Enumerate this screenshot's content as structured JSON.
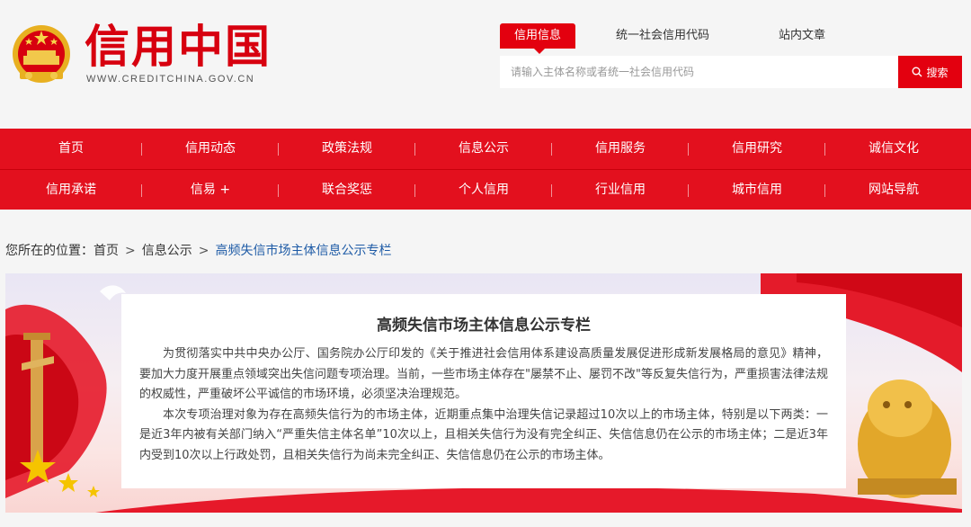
{
  "brand": {
    "title": "信用中国",
    "url": "WWW.CREDITCHINA.GOV.CN",
    "colors": {
      "primary": "#e3000f",
      "nav": "#e3101e",
      "link": "#1e5ba6"
    }
  },
  "search": {
    "tabs": [
      "信用信息",
      "统一社会信用代码",
      "站内文章"
    ],
    "active_tab": "信用信息",
    "placeholder": "请输入主体名称或者统一社会信用代码",
    "button_label": "搜索",
    "button_icon": "search-icon"
  },
  "nav": {
    "row1": [
      "首页",
      "信用动态",
      "政策法规",
      "信息公示",
      "信用服务",
      "信用研究",
      "诚信文化"
    ],
    "row2": [
      "信用承诺",
      "信易 +",
      "联合奖惩",
      "个人信用",
      "行业信用",
      "城市信用",
      "网站导航"
    ]
  },
  "breadcrumb": {
    "prefix": "您所在的位置：",
    "items": [
      "首页",
      "信息公示"
    ],
    "current": "高频失信市场主体信息公示专栏",
    "separator": ">"
  },
  "banner": {
    "title": "高频失信市场主体信息公示专栏",
    "paragraphs": [
      "为贯彻落实中共中央办公厅、国务院办公厅印发的《关于推进社会信用体系建设高质量发展促进形成新发展格局的意见》精神，要加大力度开展重点领域突出失信问题专项治理。当前，一些市场主体存在\"屡禁不止、屡罚不改\"等反复失信行为，严重损害法律法规的权威性，严重破坏公平诚信的市场环境，必须坚决治理规范。",
      "本次专项治理对象为存在高频失信行为的市场主体，近期重点集中治理失信记录超过10次以上的市场主体，特别是以下两类：一是近3年内被有关部门纳入“严重失信主体名单”10次以上，且相关失信行为没有完全纠正、失信信息仍在公示的市场主体；二是近3年内受到10次以上行政处罚，且相关失信行为尚未完全纠正、失信信息仍在公示的市场主体。"
    ]
  }
}
